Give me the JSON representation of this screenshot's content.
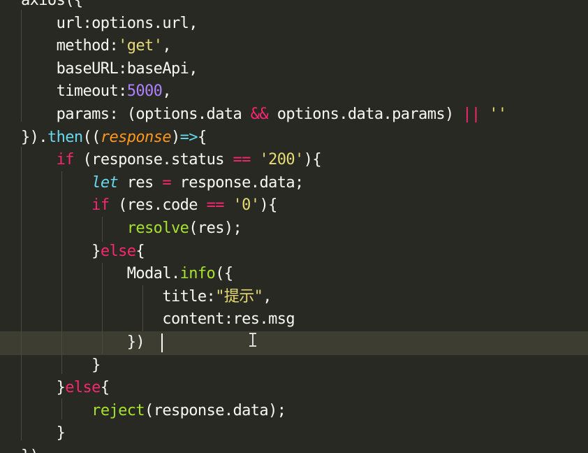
{
  "editor": {
    "colors": {
      "background": "#282923",
      "current_line": "#3e3d32",
      "default": "#f8f8f2",
      "keyword": "#f92672",
      "string": "#e6db74",
      "number": "#ae81ff",
      "function": "#a6e22e",
      "storage": "#66d9ef",
      "parameter": "#fd971f"
    },
    "lines": [
      [
        {
          "t": "axios({",
          "c": ""
        }
      ],
      [
        {
          "t": "    url:options.url,",
          "c": ""
        }
      ],
      [
        {
          "t": "    method:",
          "c": ""
        },
        {
          "t": "'get'",
          "c": "yellow"
        },
        {
          "t": ",",
          "c": ""
        }
      ],
      [
        {
          "t": "    baseURL:baseApi,",
          "c": ""
        }
      ],
      [
        {
          "t": "    timeout:",
          "c": ""
        },
        {
          "t": "5000",
          "c": "purple"
        },
        {
          "t": ",",
          "c": ""
        }
      ],
      [
        {
          "t": "    params: (options.data ",
          "c": ""
        },
        {
          "t": "&&",
          "c": "pink"
        },
        {
          "t": " options.data.params) ",
          "c": ""
        },
        {
          "t": "||",
          "c": "pink"
        },
        {
          "t": " ",
          "c": ""
        },
        {
          "t": "''",
          "c": "yellow"
        }
      ],
      [
        {
          "t": "}).",
          "c": ""
        },
        {
          "t": "then",
          "c": "cyan"
        },
        {
          "t": "((",
          "c": ""
        },
        {
          "t": "response",
          "c": "orange italic"
        },
        {
          "t": ")",
          "c": ""
        },
        {
          "t": "=>",
          "c": "cyan"
        },
        {
          "t": "{",
          "c": ""
        }
      ],
      [
        {
          "t": "    ",
          "c": ""
        },
        {
          "t": "if",
          "c": "pink"
        },
        {
          "t": " (response.status ",
          "c": ""
        },
        {
          "t": "==",
          "c": "pink"
        },
        {
          "t": " ",
          "c": ""
        },
        {
          "t": "'200'",
          "c": "yellow"
        },
        {
          "t": "){",
          "c": ""
        }
      ],
      [
        {
          "t": "        ",
          "c": ""
        },
        {
          "t": "let",
          "c": "cyan italic"
        },
        {
          "t": " res ",
          "c": ""
        },
        {
          "t": "=",
          "c": "pink"
        },
        {
          "t": " response.data;",
          "c": ""
        }
      ],
      [
        {
          "t": "        ",
          "c": ""
        },
        {
          "t": "if",
          "c": "pink"
        },
        {
          "t": " (res.code ",
          "c": ""
        },
        {
          "t": "==",
          "c": "pink"
        },
        {
          "t": " ",
          "c": ""
        },
        {
          "t": "'0'",
          "c": "yellow"
        },
        {
          "t": "){",
          "c": ""
        }
      ],
      [
        {
          "t": "            ",
          "c": ""
        },
        {
          "t": "resolve",
          "c": "green"
        },
        {
          "t": "(res);",
          "c": ""
        }
      ],
      [
        {
          "t": "        }",
          "c": ""
        },
        {
          "t": "else",
          "c": "pink"
        },
        {
          "t": "{",
          "c": ""
        }
      ],
      [
        {
          "t": "            Modal.",
          "c": ""
        },
        {
          "t": "info",
          "c": "green"
        },
        {
          "t": "({",
          "c": ""
        }
      ],
      [
        {
          "t": "                title:",
          "c": ""
        },
        {
          "t": "\"提示\"",
          "c": "yellow"
        },
        {
          "t": ",",
          "c": ""
        }
      ],
      [
        {
          "t": "                content:res.msg",
          "c": ""
        }
      ],
      [
        {
          "t": "            })",
          "c": ""
        }
      ],
      [
        {
          "t": "        }",
          "c": ""
        }
      ],
      [
        {
          "t": "    }",
          "c": ""
        },
        {
          "t": "else",
          "c": "pink"
        },
        {
          "t": "{",
          "c": ""
        }
      ],
      [
        {
          "t": "        ",
          "c": ""
        },
        {
          "t": "reject",
          "c": "green"
        },
        {
          "t": "(response.data);",
          "c": ""
        }
      ],
      [
        {
          "t": "    }",
          "c": ""
        }
      ],
      [
        {
          "t": "})",
          "c": ""
        }
      ]
    ]
  }
}
